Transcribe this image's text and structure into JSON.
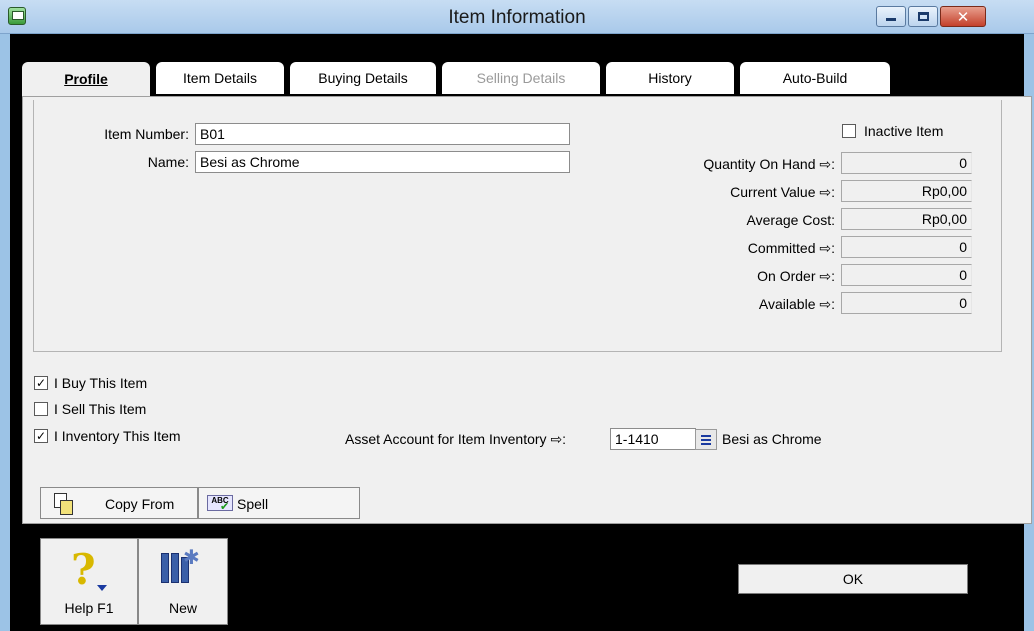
{
  "window": {
    "title": "Item Information"
  },
  "tabs": [
    {
      "label": "Profile",
      "state": "active"
    },
    {
      "label": "Item Details",
      "state": "normal"
    },
    {
      "label": "Buying Details",
      "state": "normal"
    },
    {
      "label": "Selling Details",
      "state": "disabled"
    },
    {
      "label": "History",
      "state": "normal"
    },
    {
      "label": "Auto-Build",
      "state": "normal"
    }
  ],
  "profile": {
    "item_number_label": "Item Number:",
    "item_number_value": "B01",
    "name_label": "Name:",
    "name_value": "Besi as Chrome",
    "inactive_label": "Inactive Item",
    "inactive_checked": false,
    "stats": [
      {
        "label": "Quantity On Hand",
        "arrow": "⇨",
        "value": "0"
      },
      {
        "label": "Current Value",
        "arrow": "⇨",
        "value": "Rp0,00"
      },
      {
        "label": "Average Cost",
        "arrow": "",
        "value": "Rp0,00"
      },
      {
        "label": "Committed",
        "arrow": "⇨",
        "value": "0"
      },
      {
        "label": "On Order",
        "arrow": "⇨",
        "value": "0"
      },
      {
        "label": "Available",
        "arrow": "⇨",
        "value": "0"
      }
    ],
    "options": [
      {
        "label": "I Buy This Item",
        "checked": true
      },
      {
        "label": "I Sell This Item",
        "checked": false
      },
      {
        "label": "I Inventory This Item",
        "checked": true
      }
    ],
    "asset_account_label": "Asset Account for Item Inventory",
    "asset_account_number": "1-1410",
    "asset_account_name": "Besi as Chrome"
  },
  "buttons": {
    "copy_from": "Copy From",
    "spell": "Spell",
    "help": "Help F1",
    "new": "New",
    "ok": "OK"
  },
  "icons": {
    "app": "app-icon",
    "help": "help-icon",
    "new": "new-item-icon",
    "copy": "copy-icon",
    "spell": "spell-check-icon",
    "lookup": "list-lookup-icon"
  }
}
